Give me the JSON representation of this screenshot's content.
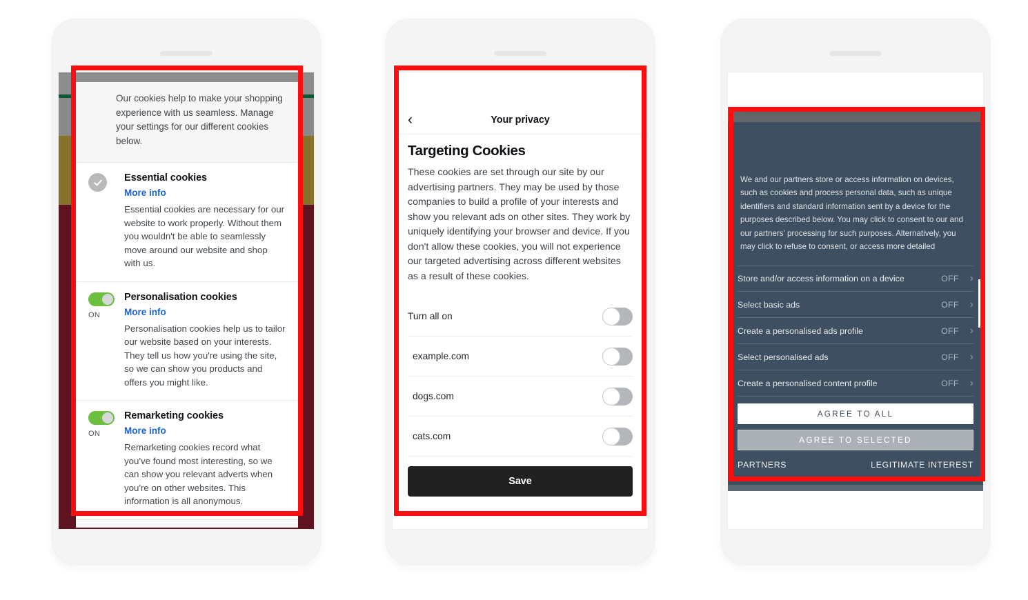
{
  "phone1": {
    "name": "cookie-settings-dialog",
    "intro": "Our cookies help to make your shopping experience with us seamless. Manage your settings for our different cookies below.",
    "rows": [
      {
        "control": "checkmark",
        "state_label": "",
        "title": "Essential cookies",
        "link": "More info",
        "description": "Essential cookies are necessary for our website to work properly. Without them you wouldn't be able to seamlessly move around our website and shop with us."
      },
      {
        "control": "toggle-on",
        "state_label": "ON",
        "title": "Personalisation cookies",
        "link": "More info",
        "description": "Personalisation cookies help us to tailor our website based on your interests. They tell us how you're using the site, so we can show you products and offers you might like."
      },
      {
        "control": "toggle-on",
        "state_label": "ON",
        "title": "Remarketing cookies",
        "link": "More info",
        "description": "Remarketing cookies record what you've found most interesting, so we can show you relevant adverts when you're on other websites. This information is all anonymous."
      }
    ],
    "colors": {
      "link": "#1a64d4",
      "toggle_on": "#6cbf3f",
      "primary_button": "#1566c8",
      "check_circle": "#b7b9bb"
    }
  },
  "phone2": {
    "name": "targeting-cookies-screen",
    "nav": {
      "back_icon": "chevron-left-icon",
      "title": "Your privacy"
    },
    "heading": "Targeting Cookies",
    "body": "These cookies are set through our site by our advertising partners. They may be used by those companies to build a profile of your interests and show you relevant ads on other sites. They work by uniquely identifying your browser and device. If you don't allow these cookies, you will not experience our targeted advertising across different websites as a result of these cookies.",
    "toggles": [
      {
        "label": "Turn all on",
        "state": "off",
        "indent": false
      },
      {
        "label": "example.com",
        "state": "off",
        "indent": true
      },
      {
        "label": "dogs.com",
        "state": "off",
        "indent": true
      },
      {
        "label": "cats.com",
        "state": "off",
        "indent": true
      }
    ],
    "save_label": "Save",
    "colors": {
      "save_button": "#212121",
      "switch_track_off": "#b3b7bb"
    }
  },
  "phone3": {
    "name": "iab-consent-panel",
    "intro": "We and our partners store or access information on devices, such as cookies and process personal data, such as unique identifiers and standard information sent by a device for the purposes described below. You may click to consent to our and our partners' processing for such purposes. Alternatively, you may click to refuse to consent, or access more detailed",
    "purposes": [
      {
        "label": "Store and/or access information on a device",
        "state": "OFF",
        "chevron": "chevron-right-icon"
      },
      {
        "label": "Select basic ads",
        "state": "OFF",
        "chevron": "chevron-right-icon"
      },
      {
        "label": "Create a personalised ads profile",
        "state": "OFF",
        "chevron": "chevron-right-icon"
      },
      {
        "label": "Select personalised ads",
        "state": "OFF",
        "chevron": "chevron-right-icon"
      },
      {
        "label": "Create a personalised content profile",
        "state": "OFF",
        "chevron": "chevron-right-icon"
      }
    ],
    "agree_all_label": "AGREE TO ALL",
    "agree_selected_label": "AGREE TO SELECTED",
    "footer_links": {
      "left": "PARTNERS",
      "right": "LEGITIMATE INTEREST"
    },
    "colors": {
      "panel_bg": "#3d4f60",
      "gray_band": "#636669",
      "agree_all_bg": "#ffffff",
      "agree_selected_bg": "#aab0b5"
    }
  },
  "annotation": {
    "highlight_color": "#fc0d10",
    "boxes": [
      "cookie-settings-dialog",
      "targeting-cookies-screen",
      "iab-consent-panel"
    ]
  }
}
